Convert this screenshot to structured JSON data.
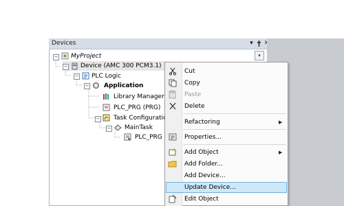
{
  "panel": {
    "title": "Devices",
    "pin_glyph": "ᵠ",
    "close_glyph": "✕",
    "dropdown_glyph": "▾"
  },
  "tree": {
    "items": [
      {
        "label": "MyProject"
      },
      {
        "label": "Device (AMC 300 PCM3.1)"
      },
      {
        "label": "PLC Logic"
      },
      {
        "label": "Application"
      },
      {
        "label": "Library Manager"
      },
      {
        "label": "PLC_PRG (PRG)"
      },
      {
        "label": "Task Configuration"
      },
      {
        "label": "MainTask"
      },
      {
        "label": "PLC_PRG"
      }
    ]
  },
  "context_menu": {
    "items": [
      {
        "label": "Cut",
        "icon": "scissors-icon"
      },
      {
        "label": "Copy",
        "icon": "copy-icon"
      },
      {
        "label": "Paste",
        "icon": "paste-icon"
      },
      {
        "label": "Delete",
        "icon": "delete-icon"
      },
      {
        "label": "Refactoring",
        "has_submenu": true
      },
      {
        "label": "Properties...",
        "icon": "properties-icon"
      },
      {
        "label": "Add Object",
        "icon": "add-object-icon",
        "has_submenu": true
      },
      {
        "label": "Add Folder...",
        "icon": "folder-icon"
      },
      {
        "label": "Add Device..."
      },
      {
        "label": "Update Device...",
        "highlighted": true
      },
      {
        "label": "Edit Object",
        "icon": "edit-object-icon"
      }
    ],
    "submenu_glyph": "▶"
  },
  "colors": {
    "highlight_bg": "#cfe8f8",
    "highlight_border": "#6fb3e1",
    "titlebar": "#d6dde6"
  }
}
